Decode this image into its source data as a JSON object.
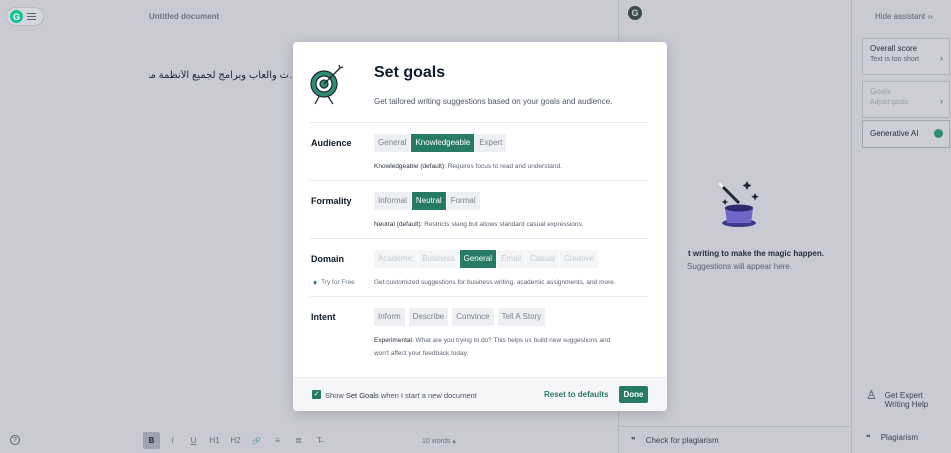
{
  "editor": {
    "doc_title": "Untitled document",
    "doc_text": "…ت والعاب وبرامج لجميع الأنظمة مجانًا",
    "help_icon": "?",
    "toolbar": [
      "B",
      "I",
      "U",
      "H1",
      "H2",
      "🔗",
      "≡",
      "≣",
      "T̶"
    ],
    "word_count": "10 words ▴"
  },
  "assistant": {
    "magic_title": "t writing to make the magic happen.",
    "magic_sub": "Suggestions will appear here.",
    "plagiarism_bar": "Check for plagiarism"
  },
  "rightbar": {
    "hide_assistant": "Hide assistant ›› ",
    "overall_score": {
      "title": "Overall score",
      "sub": "Text is too short"
    },
    "goals": {
      "title": "Goals",
      "sub": "Adjust goals"
    },
    "gen_ai": "Generative AI",
    "expert": "Get Expert Writing Help",
    "plagiarism": "Plagiarism"
  },
  "modal": {
    "title": "Set goals",
    "subtitle": "Get tailored writing suggestions based on your goals and audience.",
    "audience": {
      "label": "Audience",
      "options": [
        "General",
        "Knowledgeable",
        "Expert"
      ],
      "selected": "Knowledgeable",
      "desc_bold": "Knowledgeable (default):",
      "desc": " Requires focus to read and understand."
    },
    "formality": {
      "label": "Formality",
      "options": [
        "Informal",
        "Neutral",
        "Formal"
      ],
      "selected": "Neutral",
      "desc_bold": "Neutral (default):",
      "desc": " Restricts slang but allows standard casual expressions."
    },
    "domain": {
      "label": "Domain",
      "try_free": "Try for Free",
      "options": [
        "Academic",
        "Business",
        "General",
        "Email",
        "Casual",
        "Creative"
      ],
      "selected": "General",
      "desc": "Get customized suggestions for business writing, academic assignments, and more."
    },
    "intent": {
      "label": "Intent",
      "options": [
        "Inform",
        "Describe",
        "Convince",
        "Tell A Story"
      ],
      "desc_bold": "Experimental.",
      "desc_line1": " What are you trying to do? This helps us build new suggestions and",
      "desc_line2": "won't affect your feedback today."
    },
    "footer": {
      "show_prefix": "Show ",
      "show_bold": "Set Goals",
      "show_suffix": " when I start a new document",
      "reset": "Reset to defaults",
      "done": "Done"
    }
  },
  "colors": {
    "accent": "#277b66",
    "overlay": "#c9cad3"
  }
}
